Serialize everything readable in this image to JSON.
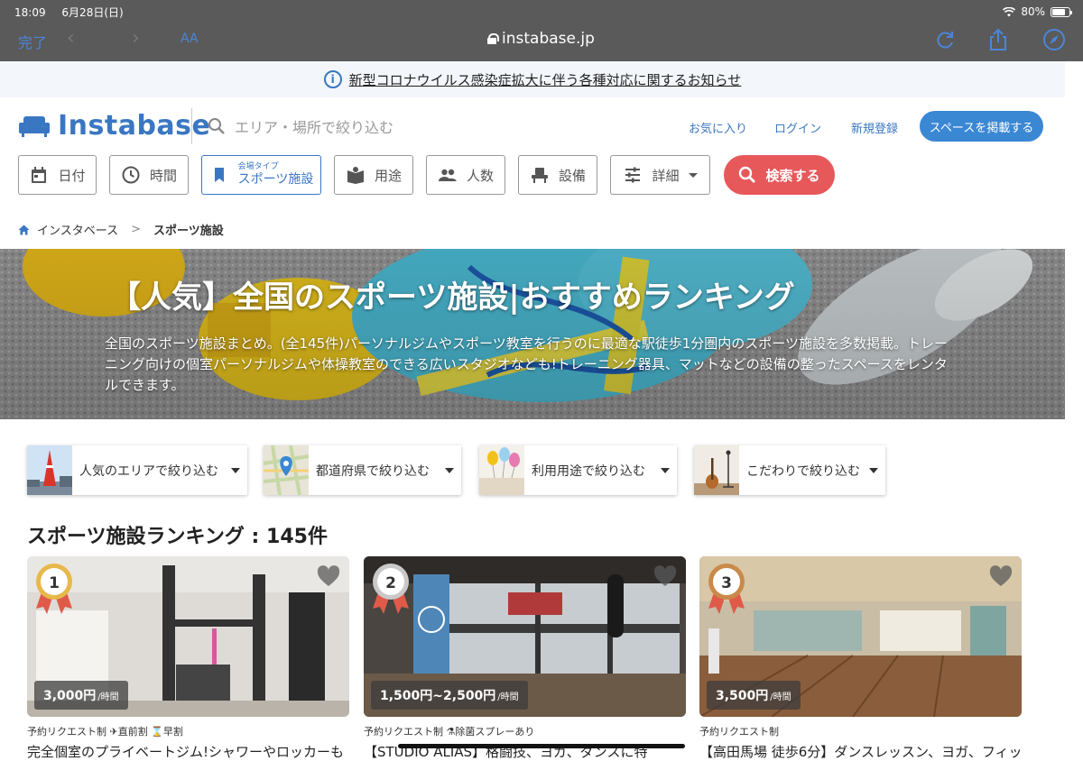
{
  "status_bar": {
    "time": "18:09",
    "date": "6月28日(日)",
    "battery": "80%"
  },
  "browser": {
    "done_label": "完了",
    "text_size_label": "AA",
    "url": "instabase.jp"
  },
  "notice": {
    "text": "新型コロナウイルス感染症拡大に伴う各種対応に関するお知らせ"
  },
  "header": {
    "logo_text": "Instabase",
    "search_placeholder": "エリア・場所で絞り込む",
    "favorites": "お気に入り",
    "login": "ログイン",
    "signup": "新規登録",
    "post_space": "スペースを掲載する"
  },
  "filters": {
    "date": "日付",
    "time": "時間",
    "venue_type_caption": "会場タイプ",
    "venue_type": "スポーツ施設",
    "purpose": "用途",
    "people": "人数",
    "equipment": "設備",
    "details": "詳細",
    "search": "検索する"
  },
  "breadcrumb": {
    "home": "インスタベース",
    "separator": ">",
    "current": "スポーツ施設"
  },
  "hero": {
    "title": "【人気】全国のスポーツ施設|おすすめランキング",
    "description": "全国のスポーツ施設まとめ。(全145件)パーソナルジムやスポーツ教室を行うのに最適な駅徒歩1分圏内のスポーツ施設を多数掲載。トレーニング向けの個室パーソナルジムや体操教室のできる広いスタジオなども!トレーニング器具、マットなどの設備の整ったスペースをレンタルできます。"
  },
  "dropdowns": [
    {
      "label": "人気のエリアで絞り込む"
    },
    {
      "label": "都道府県で絞り込む"
    },
    {
      "label": "利用用途で絞り込む"
    },
    {
      "label": "こだわりで絞り込む"
    }
  ],
  "ranking": {
    "title": "スポーツ施設ランキング : 145件"
  },
  "cards": [
    {
      "rank": "1",
      "price": "3,000円",
      "unit": "/時間",
      "tags": "予約リクエスト制 ✈直前割 ⌛早割",
      "title": "完全個室のプライベートジム!シャワーやロッカーも"
    },
    {
      "rank": "2",
      "price": "1,500円~2,500円",
      "unit": "/時間",
      "tags": "予約リクエスト制 ⚗除菌スプレーあり",
      "title": "【STUDIO ALIAS】格闘技、ヨガ、ダンスに特"
    },
    {
      "rank": "3",
      "price": "3,500円",
      "unit": "/時間",
      "tags": "予約リクエスト制",
      "title": "【高田馬場 徒歩6分】ダンスレッスン、ヨガ、フィッ"
    }
  ],
  "colors": {
    "brand": "#3a77c2",
    "search_button": "#e7585a",
    "browser_bar": "#5a5a5a"
  }
}
